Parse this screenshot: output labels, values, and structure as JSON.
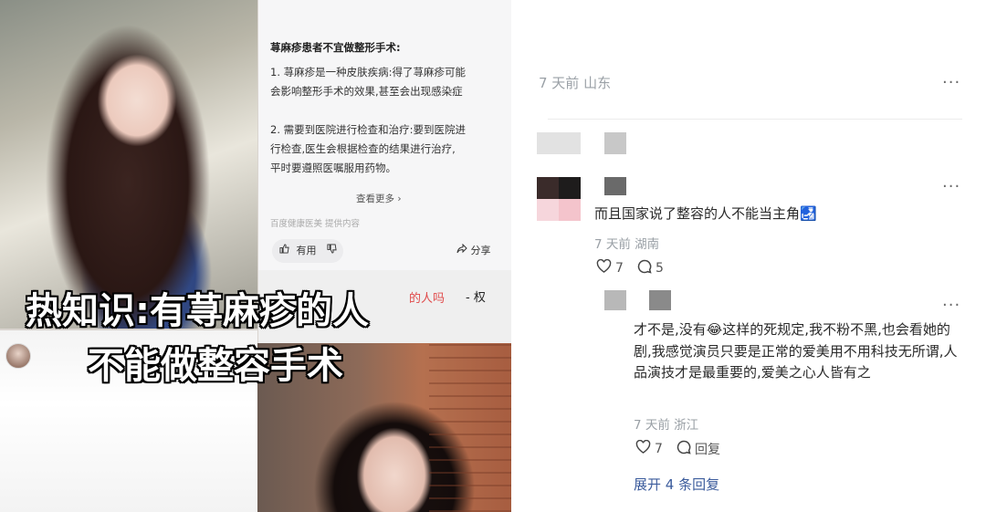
{
  "article": {
    "heading": "荨麻疹患者不宜做整形手术:",
    "lines": [
      "1. 荨麻疹是一种皮肤疾病:得了荨麻疹可能",
      "会影响整形手术的效果,甚至会出现感染症",
      "",
      "2. 需要到医院进行检查和治疗:要到医院进",
      "行检查,医生会根据检查的结果进行治疗,",
      "平时要遵照医嘱服用药物。"
    ],
    "read_more": "查看更多 ›",
    "source": "百度健康医美  提供内容",
    "useful": "有用",
    "share": "分享"
  },
  "overlay": {
    "caption_line1": "热知识:有荨麻疹的人",
    "caption_line2": "不能做整容手术",
    "snip_red": "的人吗",
    "snip_side": "- 权"
  },
  "comments": {
    "top_meta": "7 天前 山东",
    "comment1": {
      "text": "而且国家说了整容的人不能当主角🛃",
      "meta": "7 天前 湖南",
      "likes": "7",
      "replies": "5"
    },
    "reply1": {
      "text": "才不是,没有😂这样的死规定,我不粉不黑,也会看她的剧,我感觉演员只要是正常的爱美用不用科技无所谓,人品演技才是最重要的,爱美之心人皆有之",
      "meta": "7 天前 浙江",
      "likes": "7",
      "reply_label": "回复"
    },
    "expand": "展开 4 条回复",
    "more": "···"
  },
  "colors": {
    "link": "#3b5b9c",
    "meta": "#9aa0a6",
    "caption_fill": "#ffffff",
    "caption_stroke": "#000000"
  },
  "icons": [
    "thumb-up-icon",
    "thumb-down-icon",
    "share-icon",
    "heart-icon",
    "comment-icon",
    "more-icon"
  ]
}
